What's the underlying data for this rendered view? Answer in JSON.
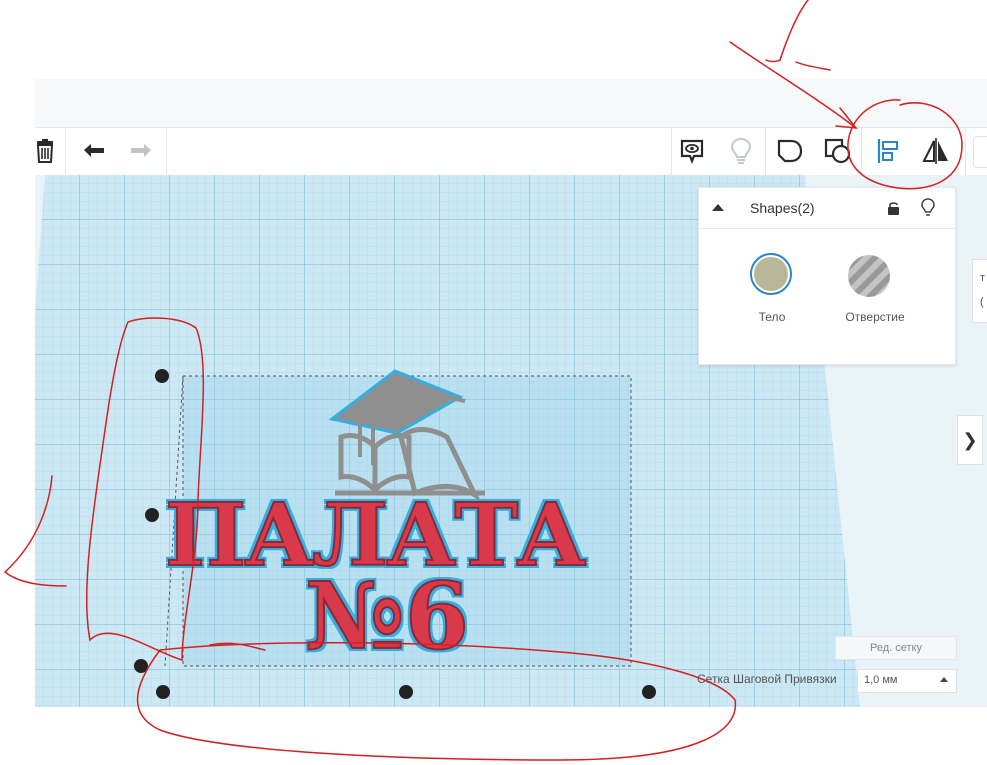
{
  "toolbar": {
    "delete_icon": "trash-icon",
    "undo_icon": "undo-arrow-icon",
    "redo_icon": "redo-arrow-icon",
    "view_icon": "speech-eye-icon",
    "light_icon": "lightbulb-icon",
    "group_icon": "group-shapes-icon",
    "ungroup_icon": "ungroup-shapes-icon",
    "align_icon": "align-icon",
    "mirror_icon": "mirror-icon"
  },
  "shapes_panel": {
    "title": "Shapes(2)",
    "solid_label": "Тело",
    "hole_label": "Отверстие",
    "solid_color": "#b8b79a"
  },
  "model": {
    "line1": "ПАЛАТА",
    "line2": "№6",
    "text_color": "#d83a4c",
    "outline_color": "#35aee0"
  },
  "grid": {
    "edit_grid_label": "Ред. сетку",
    "snap_label": "Сетка Шаговой Привязки",
    "snap_value": "1,0 мм"
  },
  "right_edge_letters": [
    "т",
    "("
  ],
  "annotations": {
    "marker_1": "1",
    "marker_2": "1"
  }
}
